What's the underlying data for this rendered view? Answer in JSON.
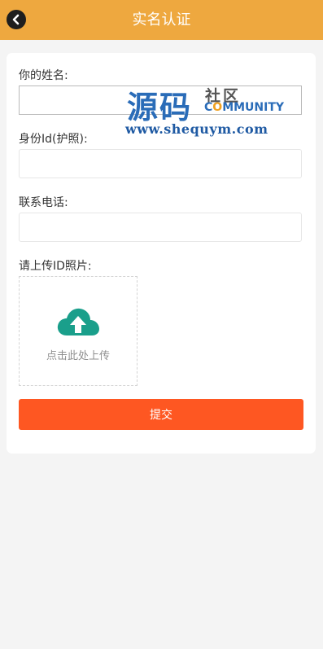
{
  "header": {
    "title": "实名认证",
    "back_icon": "chevron-left-icon",
    "color": "#eea83f"
  },
  "form": {
    "name_label": "你的姓名:",
    "name_value": "",
    "id_label": "身份Id(护照):",
    "id_value": "",
    "phone_label": "联系电话:",
    "phone_value": "",
    "photo_label": "请上传ID照片:",
    "upload_icon": "cloud-upload-icon",
    "upload_text": "点击此处上传",
    "submit_label": "提交",
    "submit_color": "#fe5722"
  },
  "watermark": {
    "big": "源码",
    "cn": "社区",
    "en_prefix": "C",
    "en_o": "O",
    "en_suffix": "MMUNITY",
    "url": "www.shequym.com"
  }
}
